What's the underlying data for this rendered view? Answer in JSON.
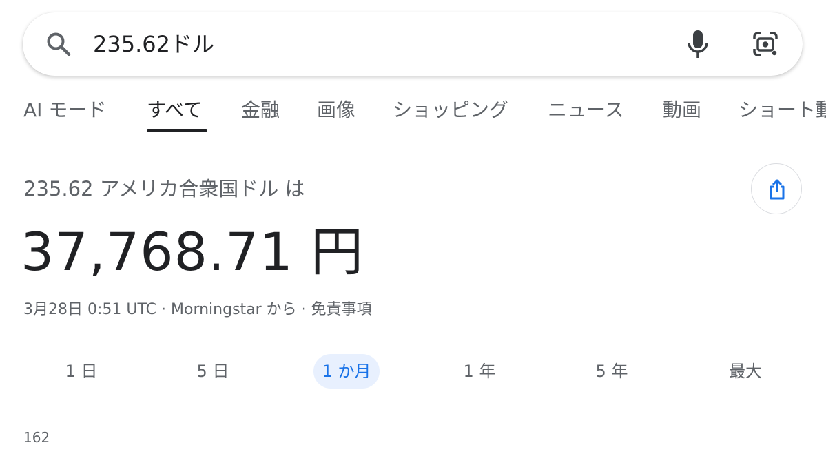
{
  "search": {
    "query": "235.62ドル",
    "icons": [
      "search-icon",
      "mic-icon",
      "lens-icon"
    ]
  },
  "tabs": [
    {
      "label": "AI モード"
    },
    {
      "label": "すべて",
      "active": true
    },
    {
      "label": "金融"
    },
    {
      "label": "画像"
    },
    {
      "label": "ショッピング"
    },
    {
      "label": "ニュース"
    },
    {
      "label": "動画"
    },
    {
      "label": "ショート動"
    }
  ],
  "converter": {
    "question": "235.62 アメリカ合衆国ドル は",
    "result": "37,768.71 円",
    "meta": {
      "timestamp": "3月28日 0:51 UTC",
      "separator": "·",
      "source": "Morningstar から",
      "disclaimer": "免責事項"
    },
    "share_icon": "share-icon"
  },
  "ranges": [
    {
      "label": "1 日"
    },
    {
      "label": "5 日"
    },
    {
      "label": "1 か月",
      "active": true
    },
    {
      "label": "1 年"
    },
    {
      "label": "5 年"
    },
    {
      "label": "最大"
    }
  ],
  "chart": {
    "y_tick": "162"
  },
  "colors": {
    "accent": "#1a73e8",
    "accent_bg": "#e8f0fe",
    "text": "#202124",
    "secondary": "#5f6368",
    "divider": "#e0e0e0"
  }
}
